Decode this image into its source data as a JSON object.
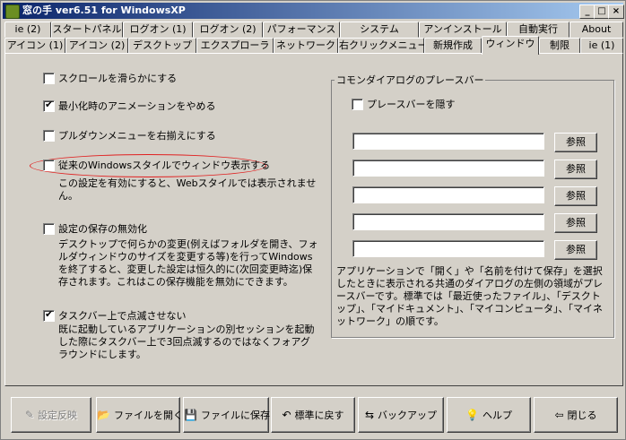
{
  "window": {
    "title": "窓の手 ver6.51 for WindowsXP"
  },
  "tabs_row1": [
    {
      "label": "ie (2)"
    },
    {
      "label": "スタートパネル"
    },
    {
      "label": "ログオン (1)"
    },
    {
      "label": "ログオン (2)"
    },
    {
      "label": "パフォーマンス"
    },
    {
      "label": "システム"
    },
    {
      "label": "アンインストール"
    },
    {
      "label": "自動実行"
    },
    {
      "label": "About"
    }
  ],
  "tabs_row2": [
    {
      "label": "アイコン (1)"
    },
    {
      "label": "アイコン (2)"
    },
    {
      "label": "デスクトップ"
    },
    {
      "label": "エクスプローラ"
    },
    {
      "label": "ネットワーク"
    },
    {
      "label": "右クリックメニュー"
    },
    {
      "label": "新規作成"
    },
    {
      "label": "ウィンドウ"
    },
    {
      "label": "制限"
    },
    {
      "label": "ie (1)"
    }
  ],
  "active_tab": "ウィンドウ",
  "options": [
    {
      "label": "スクロールを滑らかにする",
      "checked": false
    },
    {
      "label": "最小化時のアニメーションをやめる",
      "checked": true
    },
    {
      "label": "プルダウンメニューを右揃えにする",
      "checked": false
    },
    {
      "label": "従来のWindowsスタイルでウィンドウ表示する",
      "checked": false,
      "desc": "この設定を有効にすると、Webスタイルでは表示されません。"
    },
    {
      "label": "設定の保存の無効化",
      "checked": false,
      "desc": "デスクトップで何らかの変更(例えばフォルダを開き、フォルダウィンドウのサイズを変更する等)を行ってWindowsを終了すると、変更した設定は恒久的に(次回変更時迄)保存されます。これはこの保存機能を無効にできます。"
    },
    {
      "label": "タスクバー上で点滅させない",
      "checked": true,
      "desc": "既に起動しているアプリケーションの別セッションを起動した際にタスクバー上で3回点滅するのではなくフォアグラウンドにします。"
    }
  ],
  "places_bar": {
    "group_title": "コモンダイアログのプレースバー",
    "hide_label": "プレースバーを隠す",
    "hide_checked": false,
    "browse_label": "参照",
    "fields": [
      "",
      "",
      "",
      "",
      ""
    ],
    "desc": "アプリケーションで「開く」や「名前を付けて保存」を選択したときに表示される共通のダイアログの左側の領域がプレースバーです。標準では「最近使ったファイル」、「デスクトップ」、「マイドキュメント」、「マイコンピュータ」、「マイネットワーク」の順です。"
  },
  "bottom_buttons": [
    {
      "label": "設定反映",
      "icon": "apply-icon",
      "disabled": true
    },
    {
      "label": "ファイルを開く",
      "icon": "folder-open-icon",
      "disabled": false
    },
    {
      "label": "ファイルに保存",
      "icon": "floppy-icon",
      "disabled": false
    },
    {
      "label": "標準に戻す",
      "icon": "undo-icon",
      "disabled": false
    },
    {
      "label": "バックアップ",
      "icon": "backup-icon",
      "disabled": false
    },
    {
      "label": "ヘルプ",
      "icon": "help-icon",
      "disabled": false
    },
    {
      "label": "閉じる",
      "icon": "close-door-icon",
      "disabled": false
    }
  ],
  "annotation_color": "#e02020"
}
